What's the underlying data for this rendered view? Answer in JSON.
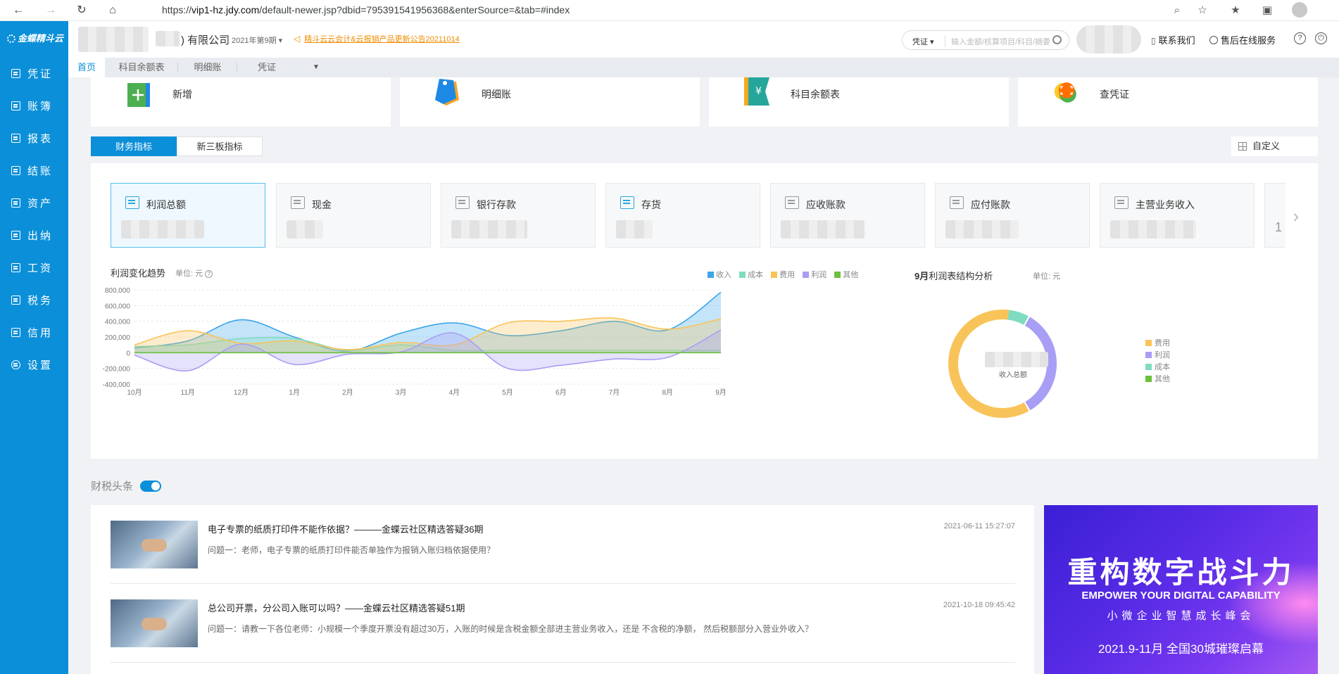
{
  "browser": {
    "url_prefix": "https://",
    "url_host": "vip1-hz.jdy.com",
    "url_path": "/default-newer.jsp?dbid=795391541956368&enterSource=&tab=#index"
  },
  "sidebar": {
    "logo": "金蝶精斗云",
    "items": [
      {
        "label": "凭证",
        "icon": "voucher-icon"
      },
      {
        "label": "账簿",
        "icon": "ledger-icon"
      },
      {
        "label": "报表",
        "icon": "report-icon"
      },
      {
        "label": "结账",
        "icon": "checkout-icon"
      },
      {
        "label": "资产",
        "icon": "asset-icon"
      },
      {
        "label": "出纳",
        "icon": "cashier-icon"
      },
      {
        "label": "工资",
        "icon": "salary-icon"
      },
      {
        "label": "税务",
        "icon": "tax-icon"
      },
      {
        "label": "信用",
        "icon": "credit-icon"
      },
      {
        "label": "设置",
        "icon": "gear-icon"
      }
    ]
  },
  "header": {
    "company_suffix": ") 有限公司",
    "period": "2021年第9期",
    "period_caret": "▾",
    "notice": "精斗云云会计&云报销产品更新公告20211014",
    "search_select": "凭证 ▾",
    "search_placeholder": "输入金额/核算项目/科目/摘要",
    "contact": "联系我们",
    "service": "售后在线服务",
    "help": "?",
    "power": "⏻"
  },
  "tabs": [
    {
      "label": "首页",
      "active": true
    },
    {
      "label": "科目余额表",
      "active": false
    },
    {
      "label": "明细账",
      "active": false
    },
    {
      "label": "凭证",
      "active": false
    }
  ],
  "quick": [
    {
      "label": "新增",
      "icon": "plus-icon",
      "color": "#4caf50"
    },
    {
      "label": "明细账",
      "icon": "tag-icon",
      "color": "#1e88e5"
    },
    {
      "label": "科目余额表",
      "icon": "yen-flag-icon",
      "color": "#26a69a"
    },
    {
      "label": "查凭证",
      "icon": "scan-icon",
      "color": "#ff6f00"
    }
  ],
  "indicator_tabs": [
    {
      "label": "财务指标",
      "active": true
    },
    {
      "label": "新三板指标",
      "active": false
    }
  ],
  "custom_label": "自定义",
  "kpis": [
    {
      "label": "利润总额",
      "cyan": true
    },
    {
      "label": "现金",
      "cyan": false
    },
    {
      "label": "银行存款",
      "cyan": false
    },
    {
      "label": "存货",
      "cyan": true
    },
    {
      "label": "应收账款",
      "cyan": false
    },
    {
      "label": "应付账款",
      "cyan": false
    },
    {
      "label": "主营业务收入",
      "cyan": false
    }
  ],
  "kpi_cut_value": "1",
  "trend": {
    "title": "利润变化趋势",
    "unit": "单位: 元",
    "help": "?"
  },
  "chart_data": {
    "type": "area",
    "categories": [
      "10月",
      "11月",
      "12月",
      "1月",
      "2月",
      "3月",
      "4月",
      "5月",
      "6月",
      "7月",
      "8月",
      "9月"
    ],
    "ylim": [
      -400000,
      800000
    ],
    "yticks": [
      "800,000",
      "600,000",
      "400,000",
      "200,000",
      "0",
      "-200,000",
      "-400,000"
    ],
    "grid": true,
    "legend_position": "top-right",
    "series": [
      {
        "name": "收入",
        "color": "#3aa6ea",
        "values": [
          60000,
          150000,
          420000,
          200000,
          20000,
          250000,
          380000,
          220000,
          280000,
          400000,
          290000,
          770000
        ]
      },
      {
        "name": "成本",
        "color": "#7fdcc0",
        "values": [
          80000,
          100000,
          180000,
          180000,
          30000,
          100000,
          30000,
          30000,
          30000,
          30000,
          30000,
          30000
        ]
      },
      {
        "name": "费用",
        "color": "#f8c45a",
        "values": [
          100000,
          280000,
          120000,
          150000,
          40000,
          130000,
          100000,
          380000,
          400000,
          440000,
          300000,
          430000
        ]
      },
      {
        "name": "利润",
        "color": "#a99ef5",
        "values": [
          -30000,
          -230000,
          110000,
          -150000,
          -20000,
          10000,
          250000,
          -200000,
          -160000,
          -80000,
          -60000,
          290000
        ]
      },
      {
        "name": "其他",
        "color": "#6cc03c",
        "values": [
          0,
          0,
          0,
          0,
          0,
          0,
          0,
          0,
          0,
          0,
          0,
          0
        ]
      }
    ]
  },
  "pie": {
    "title_bold": "9月",
    "title_rest": "利润表结构分析",
    "unit": "单位: 元",
    "center_label": "收入总额",
    "legend": [
      {
        "name": "费用",
        "color": "#f8c45a",
        "value": 0.6
      },
      {
        "name": "利润",
        "color": "#a99ef5",
        "value": 0.33
      },
      {
        "name": "成本",
        "color": "#7fdcc0",
        "value": 0.07
      },
      {
        "name": "其他",
        "color": "#6cc03c",
        "value": 0
      }
    ]
  },
  "news": {
    "heading": "财税头条",
    "items": [
      {
        "title": "电子专票的纸质打印件不能作依据？———金蝶云社区精选答疑36期",
        "desc": "问题一：老师，电子专票的纸质打印件能否单独作为报销入账归档依据使用？",
        "time": "2021-06-11 15:27:07"
      },
      {
        "title": "总公司开票，分公司入账可以吗？——金蝶云社区精选答疑51期",
        "desc": "问题一：请教一下各位老师：小规模一个季度开票没有超过30万，入账的时候是含税金额全部进主营业务收入，还是 不含税的净额， 然后税额部分入营业外收入？",
        "time": "2021-10-18 09:45:42"
      }
    ]
  },
  "banner": {
    "line1": "重构数字战斗力",
    "line2": "EMPOWER YOUR DIGITAL CAPABILITY",
    "line3": "小微企业智慧成长峰会",
    "line4": "2021.9-11月 全国30城璀璨启幕"
  }
}
